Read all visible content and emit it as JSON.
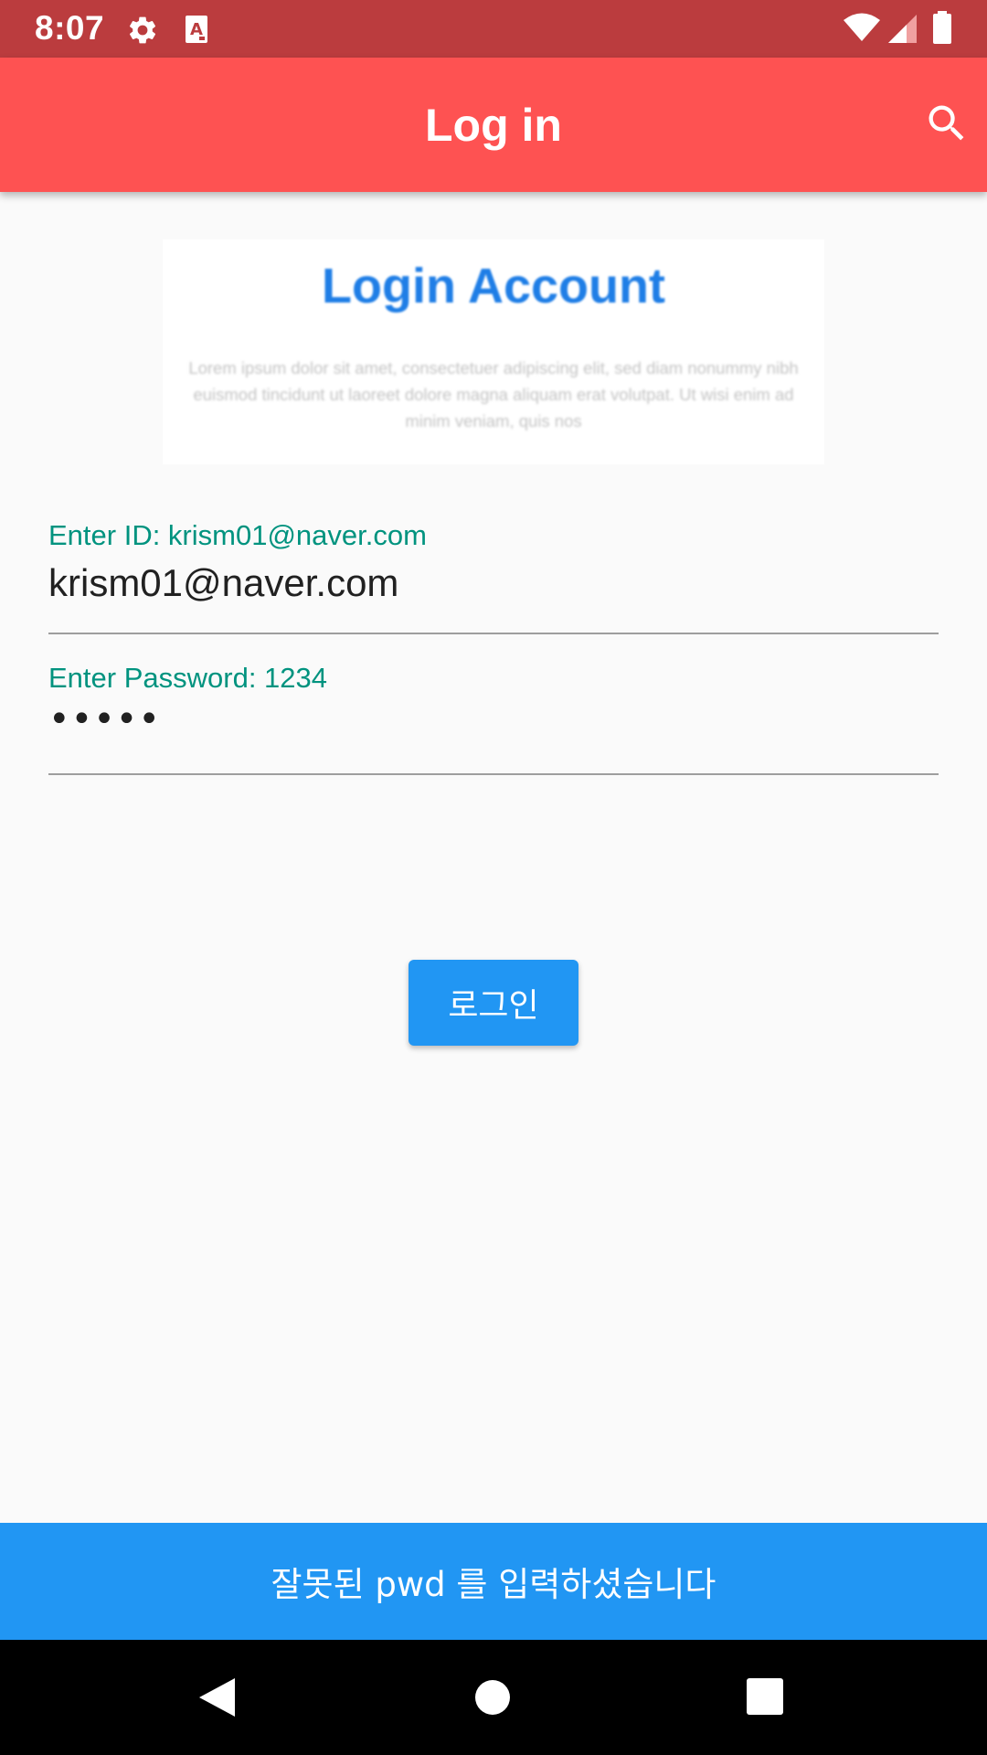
{
  "status_bar": {
    "time": "8:07",
    "left_icons": [
      "gear-icon",
      "a-box-icon"
    ],
    "right_icons": [
      "wifi-icon",
      "signal-icon",
      "battery-icon"
    ],
    "background": "#bb3c3e"
  },
  "app_bar": {
    "title": "Log in",
    "action_icon": "search-icon",
    "background": "#fe5252"
  },
  "banner": {
    "title": "Login Account",
    "body": "Lorem ipsum dolor sit amet, consectetuer adipiscing elit, sed diam nonummy nibh euismod tincidunt ut laoreet dolore magna aliquam erat volutpat. Ut wisi enim ad minim veniam, quis nos",
    "title_color": "#1f7ee6"
  },
  "form": {
    "id_field": {
      "label": "Enter ID: krism01@naver.com",
      "value": "krism01@naver.com"
    },
    "password_field": {
      "label": "Enter Password: 1234",
      "value": "•••••"
    },
    "label_color": "#00937f"
  },
  "login_button": {
    "label": "로그인",
    "color": "#2196f3"
  },
  "snackbar": {
    "message": "잘못된 pwd 를 입력하셨습니다",
    "color": "#2196f3"
  },
  "nav_bar": {
    "buttons": [
      "back-icon",
      "home-icon",
      "recents-icon"
    ]
  }
}
